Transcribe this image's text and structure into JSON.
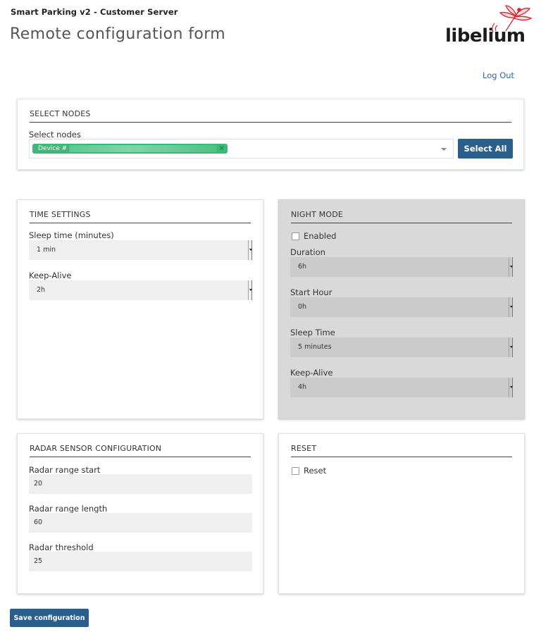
{
  "header": {
    "app_title": "Smart Parking v2 - Customer Server",
    "page_title": "Remote configuration form",
    "logo_text": "libelium",
    "logout_label": "Log Out"
  },
  "select_nodes": {
    "heading": "SELECT NODES",
    "label": "Select nodes",
    "tag_label": "Device #",
    "select_all_label": "Select All"
  },
  "time_settings": {
    "heading": "TIME SETTINGS",
    "sleep_label": "Sleep time (minutes)",
    "sleep_value": "1 min",
    "keepalive_label": "Keep-Alive",
    "keepalive_value": "2h"
  },
  "night_mode": {
    "heading": "NIGHT MODE",
    "enabled_label": "Enabled",
    "duration_label": "Duration",
    "duration_value": "6h",
    "start_hour_label": "Start Hour",
    "start_hour_value": "0h",
    "sleep_time_label": "Sleep Time",
    "sleep_time_value": "5 minutes",
    "keepalive_label": "Keep-Alive",
    "keepalive_value": "4h"
  },
  "radar": {
    "heading": "RADAR SENSOR CONFIGURATION",
    "range_start_label": "Radar range start",
    "range_start_value": "20",
    "range_length_label": "Radar range length",
    "range_length_value": "60",
    "threshold_label": "Radar threshold",
    "threshold_value": "25"
  },
  "reset": {
    "heading": "RESET",
    "reset_label": "Reset"
  },
  "footer": {
    "save_label": "Save configuration"
  },
  "colors": {
    "primary_button": "#2b5f8b",
    "link": "#2f6b9c",
    "tag": "#3cb878",
    "logo_accent": "#d9252f"
  }
}
